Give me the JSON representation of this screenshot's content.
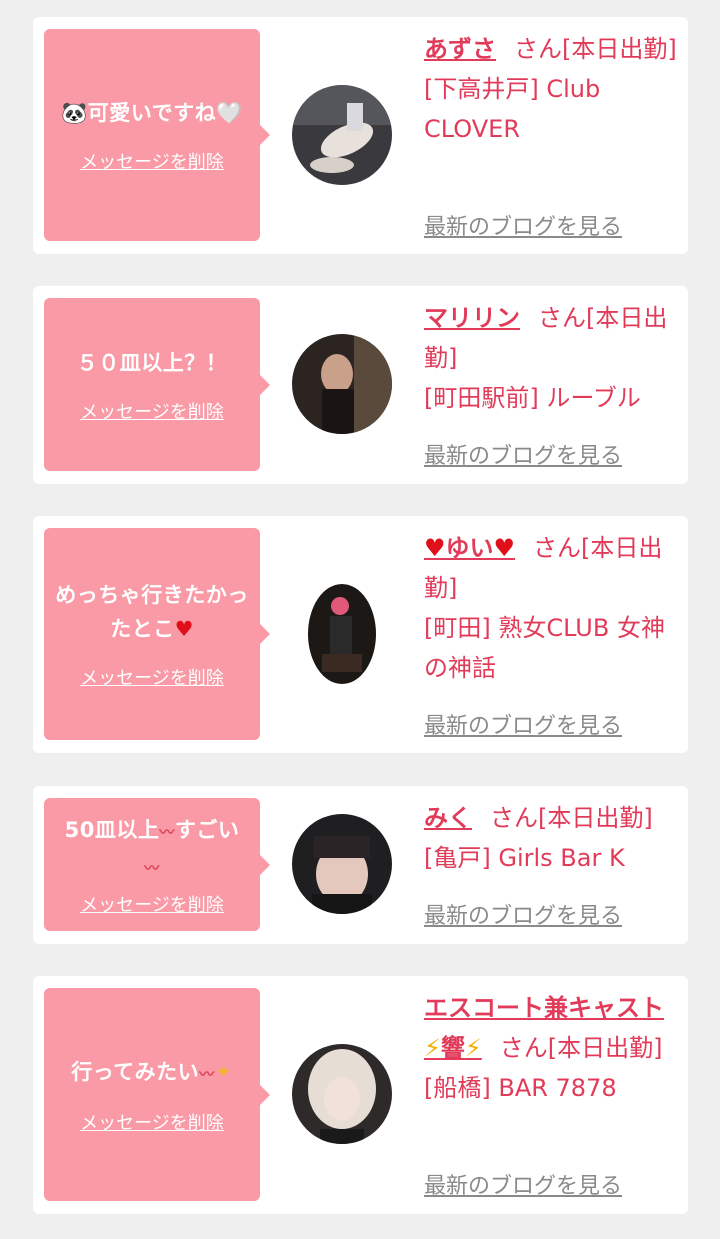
{
  "delete_label": "メッセージを削除",
  "blog_label": "最新のブログを見る",
  "san_status": "さん[本日出勤]",
  "cards": [
    {
      "message": "🐼可愛いですね🤍",
      "name": "あずさ",
      "shop": "[下高井戸] Club CLOVER"
    },
    {
      "message": "５０皿以上？！",
      "name": "マリリン",
      "shop": "[町田駅前] ルーブル"
    },
    {
      "message": "めっちゃ行きたかったとこ",
      "name": "ゆい",
      "shop": "[町田] 熟女CLUB 女神の神話"
    },
    {
      "message": "50皿以上",
      "message_b": "すごい",
      "name": "みく",
      "shop": "[亀戸] Girls Bar K"
    },
    {
      "message": "行ってみたい",
      "name_line1": "エスコート兼キャスト",
      "name_line2": "響",
      "shop": "[船橋] BAR 7878"
    }
  ],
  "colors": {
    "accent": "#e23b5a",
    "bubble": "#f99aa6",
    "link_gray": "#8a8a8a",
    "background": "#efefef"
  }
}
